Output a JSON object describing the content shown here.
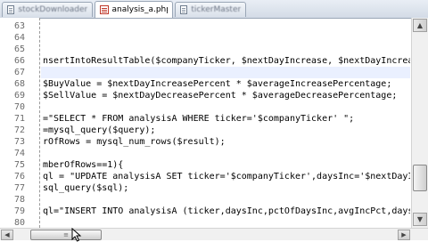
{
  "tabs": [
    {
      "label": "stockDownloader.php",
      "active": false
    },
    {
      "label": "analysis_a.php",
      "active": true
    },
    {
      "label": "tickerMaster.txt",
      "active": false
    }
  ],
  "line_numbers": [
    "63",
    "64",
    "65",
    "66",
    "67",
    "68",
    "69",
    "70",
    "71",
    "72",
    "73",
    "74",
    "75",
    "76",
    "77",
    "78",
    "79",
    "80"
  ],
  "code_lines": [
    "",
    "",
    "",
    "nsertIntoResultTable($companyTicker, $nextDayIncrease, $nextDayIncrea",
    "",
    "$BuyValue = $nextDayIncreasePercent * $averageIncreasePercentage;",
    "$SellValue = $nextDayDecreasePercent * $averageDecreasePercentage;",
    "",
    "=\"SELECT * FROM analysisA WHERE ticker='$companyTicker' \";",
    "=mysql_query($query);",
    "rOfRows = mysql_num_rows($result);",
    "",
    "mberOfRows==1){",
    "ql = \"UPDATE analysisA SET ticker='$companyTicker',daysInc='$nextDayI",
    "sql_query($sql);",
    "",
    "ql=\"INSERT INTO analysisA (ticker,daysInc,pctOfDaysInc,avgIncPct,days",
    ""
  ],
  "colors": {
    "current_line": "#eaf0ff",
    "gutter_text": "#6b6b6b"
  },
  "scroll_grip": "≡"
}
